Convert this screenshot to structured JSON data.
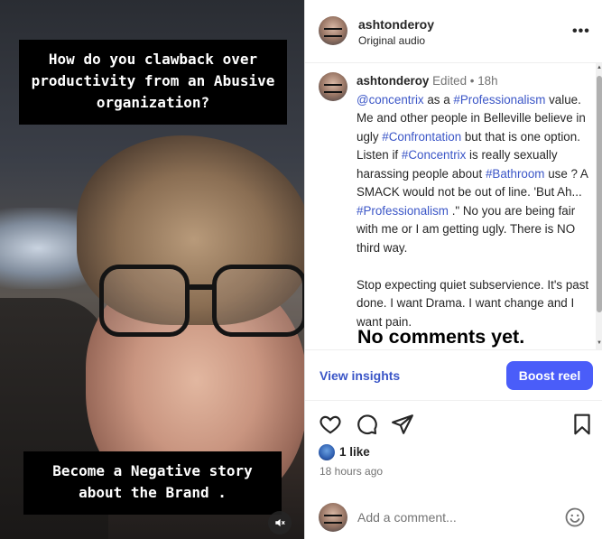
{
  "media": {
    "caption_top": "How do you clawback over productivity from an Abusive organization?",
    "caption_bottom": "Become a Negative story about the Brand ."
  },
  "post": {
    "username": "ashtonderoy",
    "audio": "Original audio",
    "more": "•••",
    "caption_meta": "Edited • 18h",
    "caption_segments": [
      {
        "t": "@concentrix",
        "tag": true
      },
      {
        "t": " as a ",
        "tag": false
      },
      {
        "t": "#Professionalism",
        "tag": true
      },
      {
        "t": " value. Me and other people in Belleville believe in ugly ",
        "tag": false
      },
      {
        "t": "#Confrontation",
        "tag": true
      },
      {
        "t": " but that is one option. Listen if ",
        "tag": false
      },
      {
        "t": "#Concentrix",
        "tag": true
      },
      {
        "t": " is really sexually harassing people about ",
        "tag": false
      },
      {
        "t": "#Bathroom",
        "tag": true
      },
      {
        "t": " use ? A SMACK would not be out of line. 'But Ah... ",
        "tag": false
      },
      {
        "t": "#Professionalism",
        "tag": true
      },
      {
        "t": " .\" No you are being fair with me or I am getting ugly. There is NO third way.",
        "tag": false
      }
    ],
    "caption_para2": "Stop expecting quiet subservience. It's past done. I want Drama. I want change and I want pain.",
    "no_comments": "No comments yet.",
    "view_insights": "View insights",
    "boost_reel": "Boost reel",
    "likes": "1 like",
    "time_ago": "18 hours ago",
    "comment_placeholder": "Add a comment..."
  },
  "colors": {
    "accent": "#4a5df9",
    "link": "#3b56c7",
    "muted": "#737373"
  },
  "icons": {
    "like": "heart-icon",
    "comment": "comment-icon",
    "share": "paper-plane-icon",
    "save": "bookmark-icon",
    "emoji": "smiley-icon",
    "mute": "speaker-muted-icon"
  }
}
